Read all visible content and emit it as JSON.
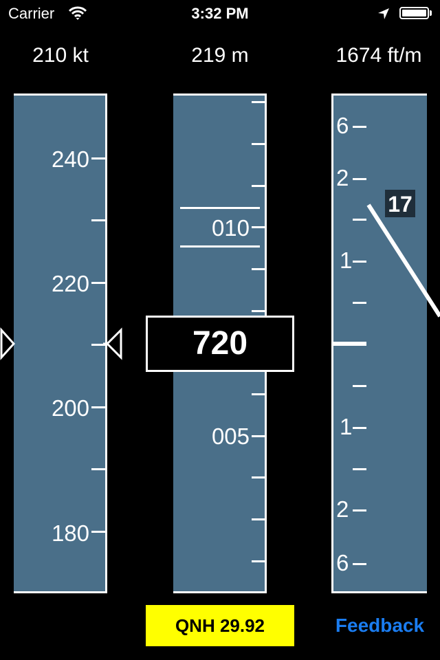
{
  "status_bar": {
    "carrier": "Carrier",
    "time": "3:32 PM",
    "icons": [
      "wifi-icon",
      "location-arrow-icon",
      "battery-icon"
    ]
  },
  "readouts": {
    "airspeed": "210 kt",
    "altitude": "219 m",
    "vertical_speed": "1674 ft/m"
  },
  "speed_tape": {
    "current_value": 210,
    "labels": [
      {
        "value": 240,
        "text": "240"
      },
      {
        "value": 220,
        "text": "220"
      },
      {
        "value": 200,
        "text": "200"
      },
      {
        "value": 180,
        "text": "180"
      }
    ],
    "minor_ticks": [
      230,
      210,
      190
    ]
  },
  "altitude_tape": {
    "current_value": "720",
    "labels": [
      {
        "text": "010"
      },
      {
        "text": "005"
      }
    ]
  },
  "vsi_tape": {
    "labels_up": [
      "6",
      "2",
      "1"
    ],
    "labels_down": [
      "1",
      "2",
      "6"
    ],
    "vs_indicator": "17"
  },
  "buttons": {
    "qnh": "QNH 29.92",
    "feedback": "Feedback"
  },
  "colors": {
    "tape": "#4a6f89",
    "qnh_bg": "#ffff00",
    "feedback": "#1a7cf0",
    "vs_box": "#1f2e3a"
  }
}
